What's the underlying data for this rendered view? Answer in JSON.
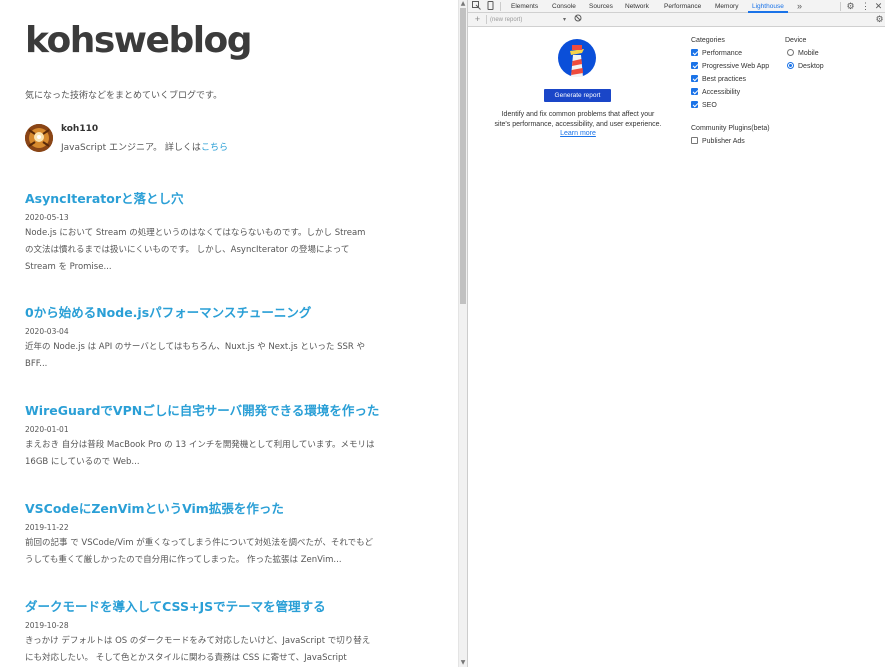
{
  "blog": {
    "title": "kohsweblog",
    "description": "気になった技術などをまとめていくブログです。",
    "author": {
      "name": "koh110",
      "bio_prefix": "JavaScript エンジニア。 詳しくは",
      "bio_link": "こちら"
    },
    "posts": [
      {
        "title": "AsyncIteratorと落とし穴",
        "date": "2020-05-13",
        "excerpt": "Node.js において Stream の処理というのはなくてはならないものです。しかし Stream の文法は慣れるまでは扱いにくいものです。 しかし、AsyncIterator の登場によって Stream を Promise..."
      },
      {
        "title": "0から始めるNode.jsパフォーマンスチューニング",
        "date": "2020-03-04",
        "excerpt": "近年の Node.js は API のサーバとしてはもちろん、Nuxt.js や Next.js といった SSR や BFF..."
      },
      {
        "title": "WireGuardでVPNごしに自宅サーバ開発できる環境を作った",
        "date": "2020-01-01",
        "excerpt": "まえおき 自分は普段 MacBook Pro の 13 インチを開発機として利用しています。メモリは 16GB にしているので Web..."
      },
      {
        "title": "VSCodeにZenVimというVim拡張を作った",
        "date": "2019-11-22",
        "excerpt": "前回の記事 で VSCode/Vim が重くなってしまう件について対処法を調べたが、それでもどうしても重くて厳しかったので自分用に作ってしまった。 作った拡張は ZenVim..."
      },
      {
        "title": "ダークモードを導入してCSS+JSでテーマを管理する",
        "date": "2019-10-28",
        "excerpt": "きっかけ デフォルトは OS のダークモードをみて対応したいけど、JavaScript で切り替えにも対応したい。 そして色とかスタイルに関わる責務は CSS に寄せて、JavaScript"
      }
    ]
  },
  "devtools": {
    "tabs": [
      "Elements",
      "Console",
      "Sources",
      "Network",
      "Performance",
      "Memory",
      "Lighthouse"
    ],
    "active_tab": "Lighthouse",
    "icons": {
      "inspect": "inspect-element-icon",
      "device": "device-toolbar-icon",
      "more_tabs": "chevron-double-right-icon",
      "settings": "gear-icon",
      "menu": "kebab-menu-icon",
      "close": "close-icon",
      "add": "plus-icon",
      "clear": "block-icon"
    },
    "toolbar": {
      "report_select": "(new report)"
    },
    "lighthouse": {
      "generate_button": "Generate report",
      "description": "Identify and fix common problems that affect your site's performance, accessibility, and user experience.",
      "learn_more": "Learn more",
      "categories_heading": "Categories",
      "categories": [
        {
          "label": "Performance",
          "checked": true
        },
        {
          "label": "Progressive Web App",
          "checked": true
        },
        {
          "label": "Best practices",
          "checked": true
        },
        {
          "label": "Accessibility",
          "checked": true
        },
        {
          "label": "SEO",
          "checked": true
        }
      ],
      "device_heading": "Device",
      "devices": [
        {
          "label": "Mobile",
          "selected": false
        },
        {
          "label": "Desktop",
          "selected": true
        }
      ],
      "plugins_heading": "Community Plugins(beta)",
      "plugins": [
        {
          "label": "Publisher Ads",
          "checked": false
        }
      ]
    },
    "colors": {
      "accent": "#1a73e8",
      "button": "#1a46c8",
      "logo_circle": "#0b4fd9",
      "logo_tower": "#ef4b3d"
    }
  }
}
